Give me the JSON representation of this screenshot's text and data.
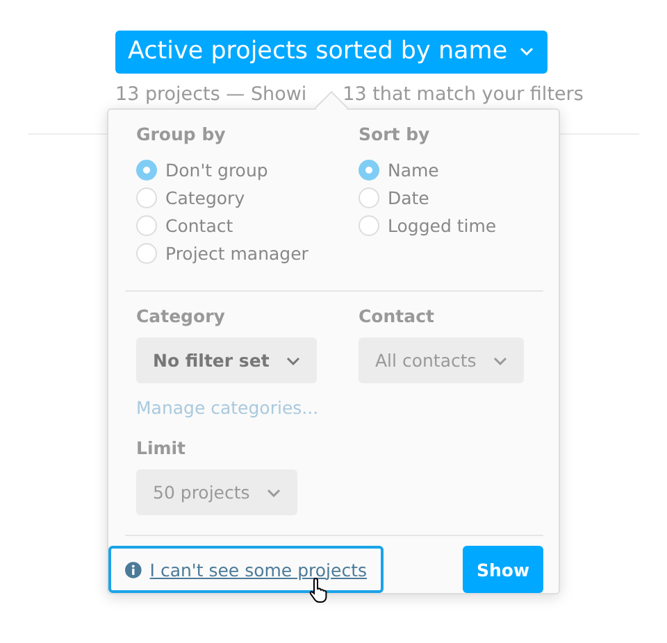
{
  "title_button": {
    "label": "Active projects sorted by name"
  },
  "summary": {
    "before": "13 projects — Showi",
    "after": "13 that match your filters"
  },
  "popover": {
    "group_by": {
      "label": "Group by",
      "options": [
        {
          "label": "Don't group",
          "selected": true
        },
        {
          "label": "Category",
          "selected": false
        },
        {
          "label": "Contact",
          "selected": false
        },
        {
          "label": "Project manager",
          "selected": false
        }
      ]
    },
    "sort_by": {
      "label": "Sort by",
      "options": [
        {
          "label": "Name",
          "selected": true
        },
        {
          "label": "Date",
          "selected": false
        },
        {
          "label": "Logged time",
          "selected": false
        }
      ]
    },
    "category": {
      "label": "Category",
      "value": "No filter set",
      "active": true
    },
    "contact": {
      "label": "Contact",
      "value": "All contacts",
      "active": false
    },
    "manage_link": "Manage categories...",
    "limit": {
      "label": "Limit",
      "value": "50 projects",
      "active": false
    },
    "help_link": {
      "label": "I can't see some projects",
      "focused": true
    },
    "show_button": "Show"
  }
}
